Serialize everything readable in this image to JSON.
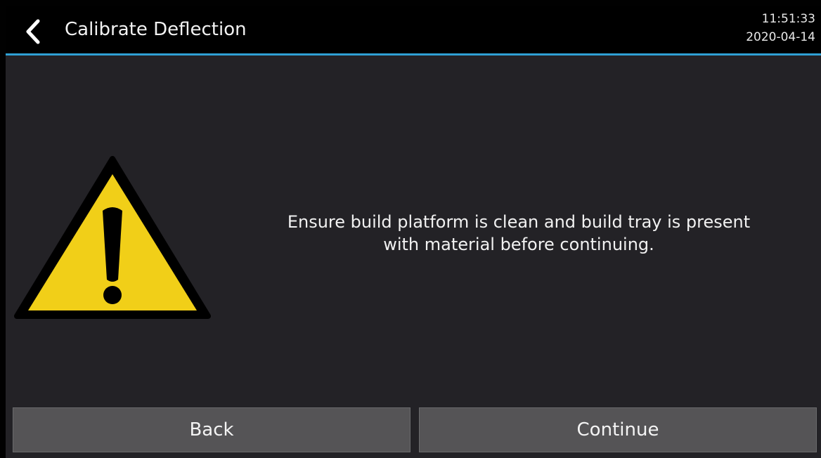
{
  "header": {
    "title": "Calibrate Deflection",
    "time": "11:51:33",
    "date": "2020-04-14",
    "back_icon": "chevron-left-icon",
    "accent_color": "#2fa0d4"
  },
  "main": {
    "warning_icon": "warning-triangle-icon",
    "warning_color": "#f1cf18",
    "message_line1": "Ensure build platform is clean and build tray is present",
    "message_line2": "with material before continuing."
  },
  "footer": {
    "back_label": "Back",
    "continue_label": "Continue"
  }
}
